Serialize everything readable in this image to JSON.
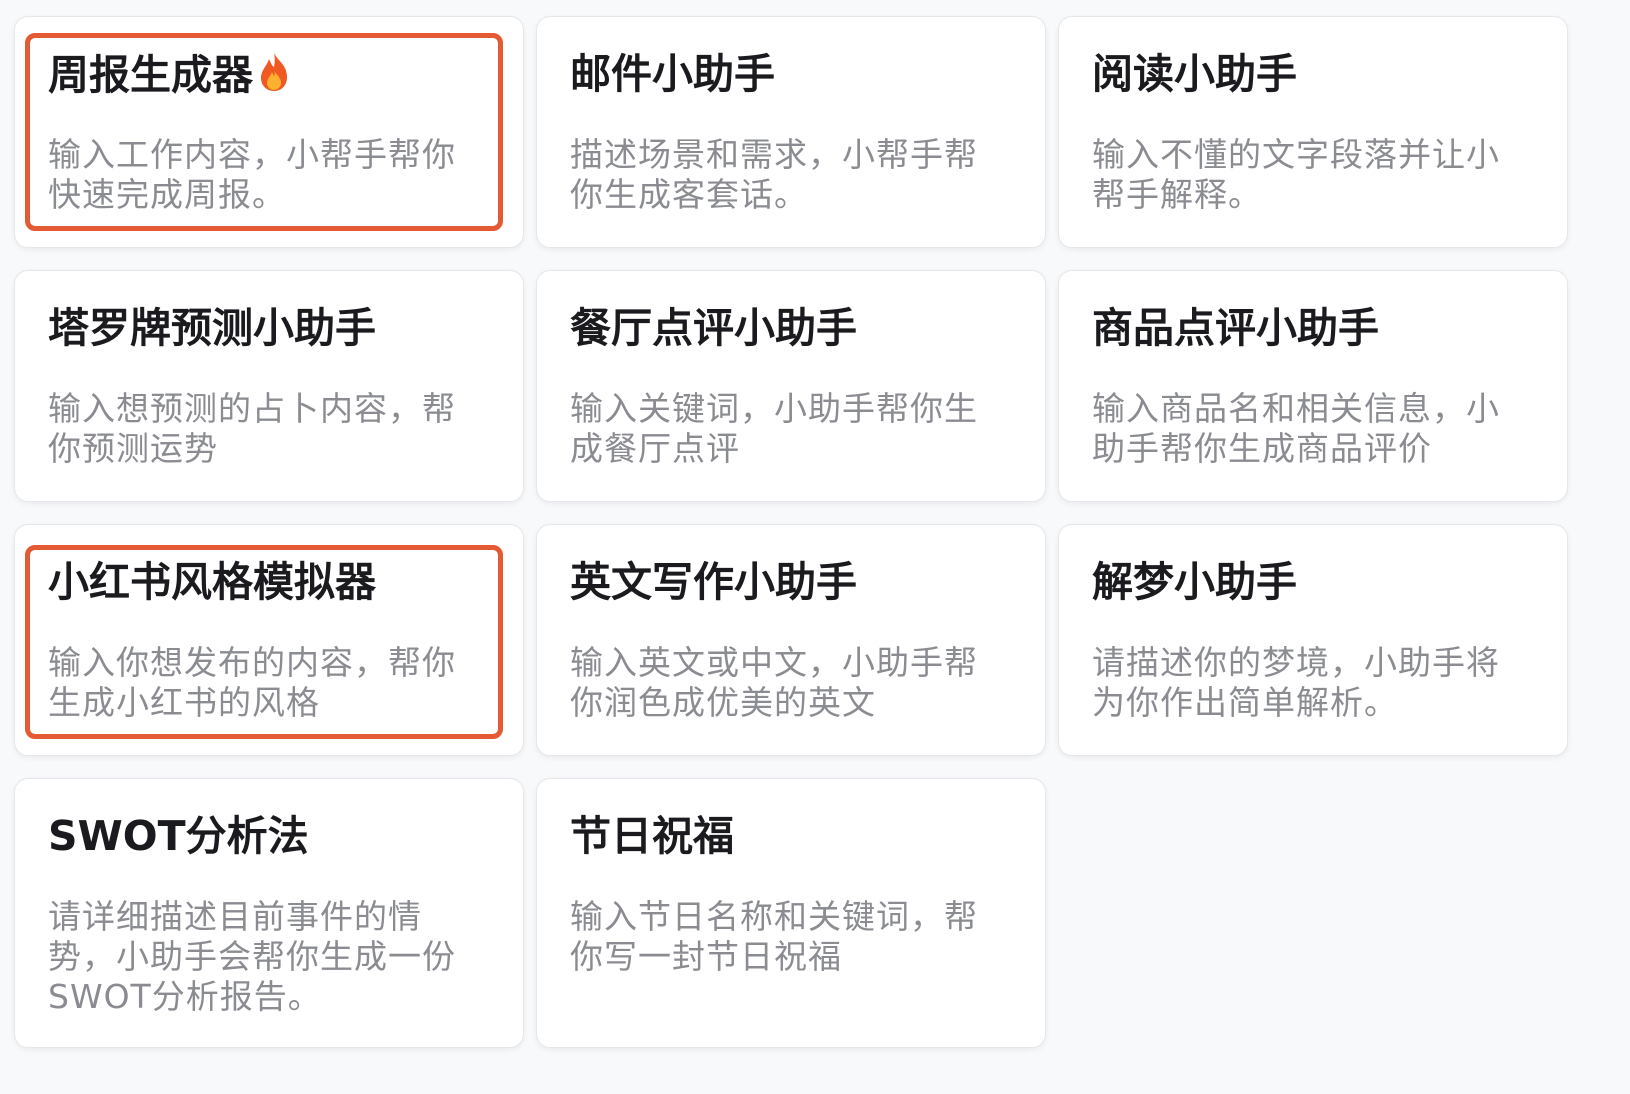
{
  "highlight_color": "#e35a34",
  "cards": [
    {
      "title": "周报生成器",
      "icon": "fire-icon",
      "desc": "输入工作内容，小帮手帮你快速完成周报。",
      "highlighted": true
    },
    {
      "title": "邮件小助手",
      "desc": "描述场景和需求，小帮手帮你生成客套话。"
    },
    {
      "title": "阅读小助手",
      "desc": "输入不懂的文字段落并让小帮手解释。"
    },
    {
      "title": "塔罗牌预测小助手",
      "desc": "输入想预测的占卜内容，帮你预测运势"
    },
    {
      "title": "餐厅点评小助手",
      "desc": "输入关键词，小助手帮你生成餐厅点评"
    },
    {
      "title": "商品点评小助手",
      "desc": "输入商品名和相关信息，小助手帮你生成商品评价"
    },
    {
      "title": "小红书风格模拟器",
      "desc": "输入你想发布的内容，帮你生成小红书的风格",
      "highlighted": true
    },
    {
      "title": "英文写作小助手",
      "desc": "输入英文或中文，小助手帮你润色成优美的英文"
    },
    {
      "title": "解梦小助手",
      "desc": "请描述你的梦境，小助手将为你作出简单解析。"
    },
    {
      "title": "SWOT分析法",
      "desc": "请详细描述目前事件的情势，小助手会帮你生成一份SWOT分析报告。"
    },
    {
      "title": "节日祝福",
      "desc": "输入节日名称和关键词，帮你写一封节日祝福"
    }
  ]
}
